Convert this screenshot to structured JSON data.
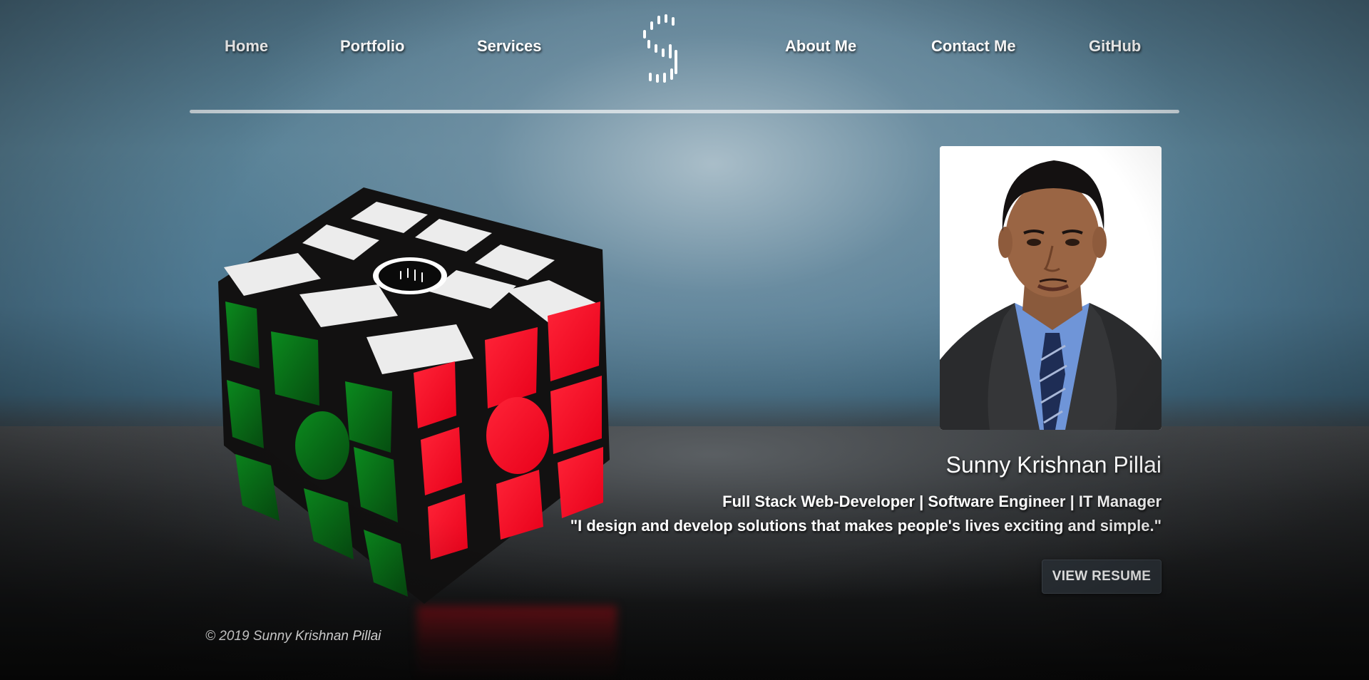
{
  "nav": {
    "links": [
      {
        "label": "Home"
      },
      {
        "label": "Portfolio"
      },
      {
        "label": "Services"
      },
      {
        "label": "About Me"
      },
      {
        "label": "Contact Me"
      },
      {
        "label": "GitHub"
      }
    ],
    "logo_icon": "dashed-s-logo-icon"
  },
  "hero": {
    "image": "rubiks-cube-photo",
    "cube_colors": {
      "white": "#ececec",
      "green": "#0f7a1a",
      "red": "#ff1428",
      "body": "#121111"
    }
  },
  "profile": {
    "photo": "profile-photo",
    "name": "Sunny Krishnan Pillai",
    "title": "Full Stack Web-Developer | Software Engineer | IT Manager",
    "quote": "\"I design and develop solutions that makes people's lives exciting and simple.\"",
    "resume_button_label": "VIEW RESUME"
  },
  "footer": {
    "copyright": "© 2019 Sunny Krishnan Pillai"
  }
}
